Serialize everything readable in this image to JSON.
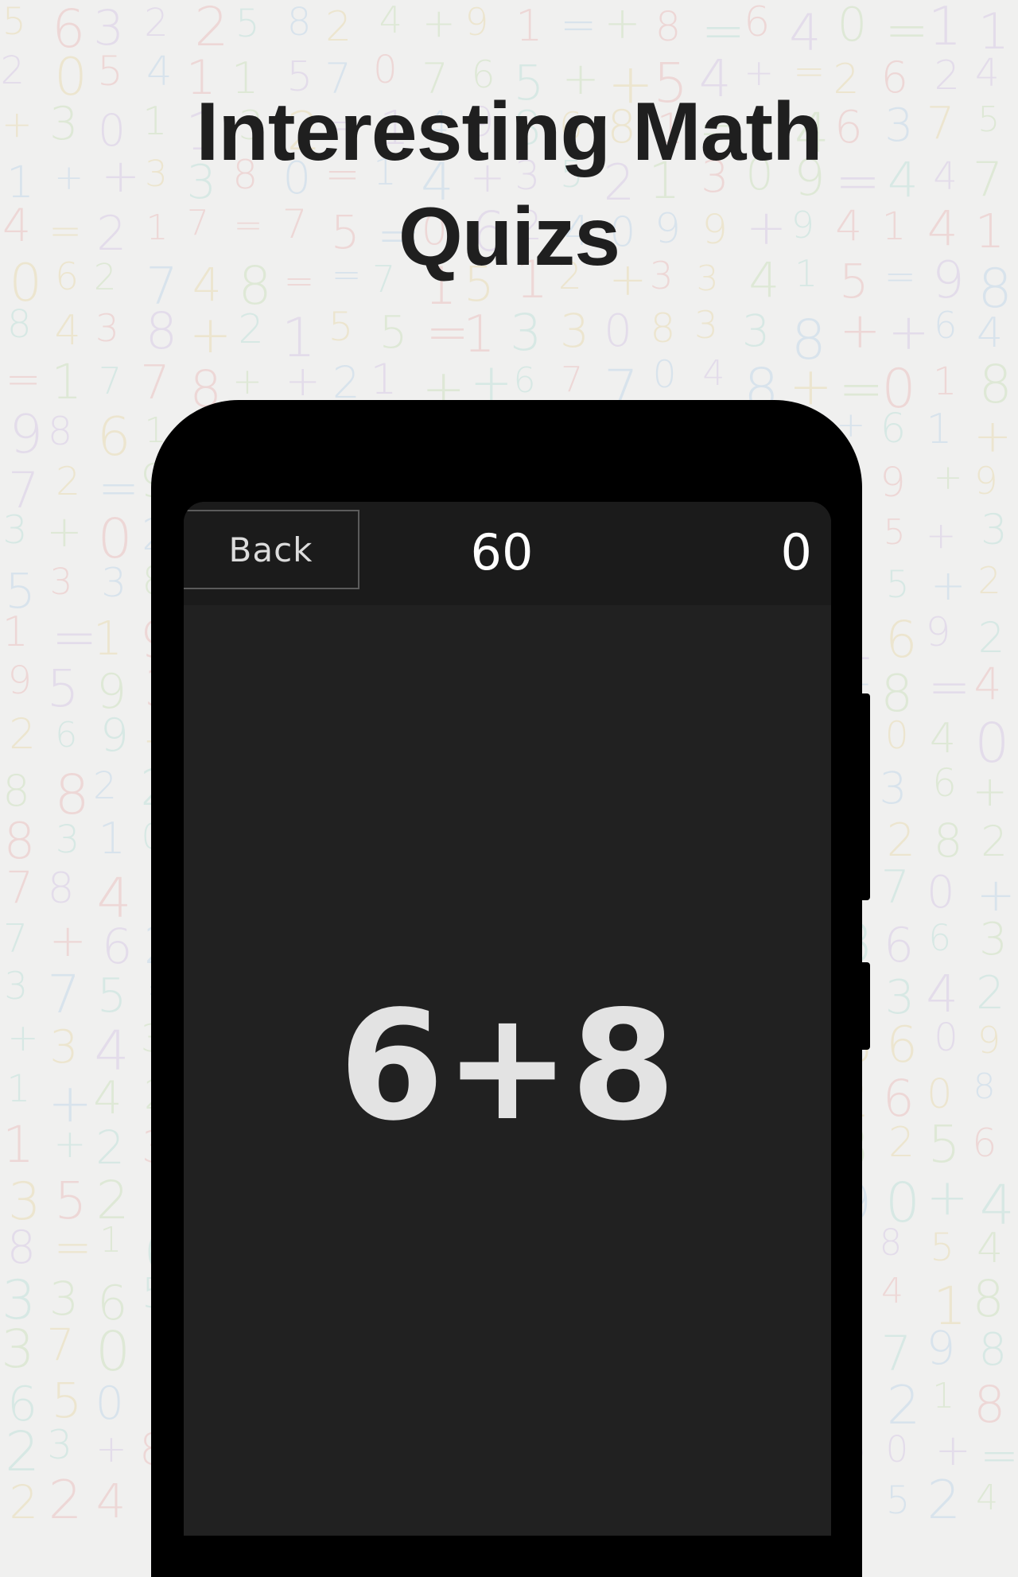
{
  "promo": {
    "title_line1": "Interesting Math",
    "title_line2": "Quizs"
  },
  "game": {
    "back_label": "Back",
    "timer": "60",
    "score": "0",
    "question": "6+8"
  },
  "colors": {
    "page_background": "#f0f0ef",
    "headline": "#1f1f1f",
    "phone_body": "#000000",
    "screen_background": "#212121",
    "topbar_background": "#1b1b1b",
    "question_text": "#e3e3e3",
    "background_digit_palette": [
      "#e8a3a3",
      "#a9c9e6",
      "#b9d9a3",
      "#e6d18f",
      "#c9b3e0",
      "#a3d9cf"
    ]
  }
}
